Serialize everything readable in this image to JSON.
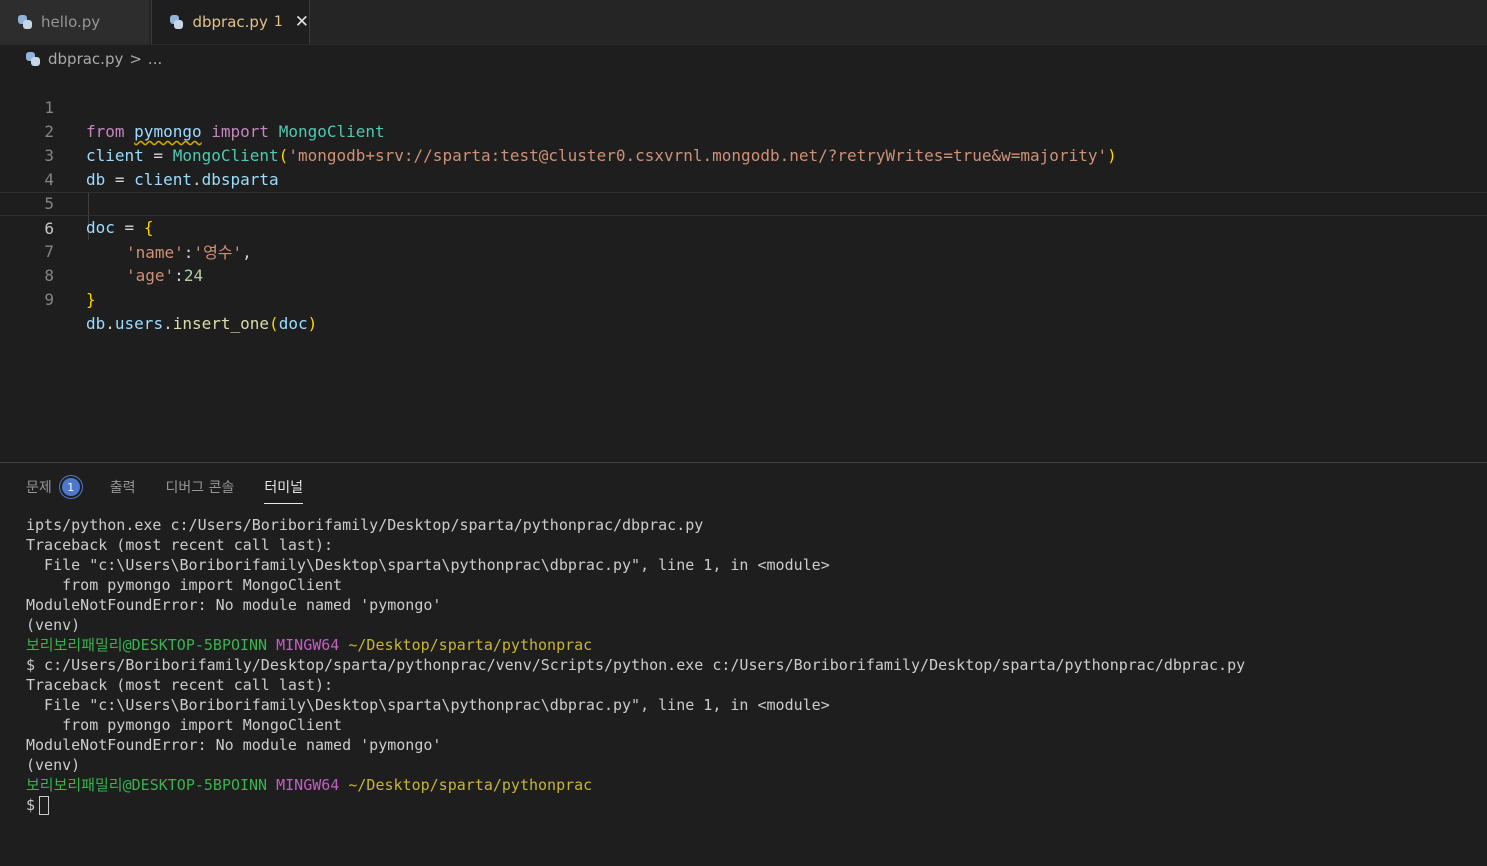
{
  "tabs": [
    {
      "label": "hello.py",
      "active": false
    },
    {
      "label": "dbprac.py",
      "badge": "1",
      "active": true
    }
  ],
  "close_glyph": "✕",
  "breadcrumb": {
    "file": "dbprac.py",
    "separator": ">",
    "more": "..."
  },
  "editor": {
    "line_numbers": [
      "1",
      "2",
      "3",
      "4",
      "5",
      "6",
      "7",
      "8",
      "9"
    ],
    "current_line": 6,
    "line1": {
      "kw1": "from",
      "module": "pymongo",
      "kw2": "import",
      "cls": "MongoClient"
    },
    "line2": {
      "var": "client",
      "eq": " = ",
      "cls": "MongoClient",
      "open": "(",
      "str": "'mongodb+srv://sparta:test@cluster0.csxvrnl.mongodb.net/?retryWrites=true&w=majority'",
      "close": ")"
    },
    "line3": {
      "var": "db",
      "eq": " = ",
      "obj": "client",
      "dot": ".",
      "attr": "dbsparta"
    },
    "line5": {
      "var": "doc",
      "eq": " = ",
      "brace": "{"
    },
    "line6": {
      "key": "'name'",
      "colon": ":",
      "val": "'영수'",
      "comma": ","
    },
    "line7": {
      "key": "'age'",
      "colon": ":",
      "num": "24"
    },
    "line8": {
      "brace": "}"
    },
    "line9": {
      "obj": "db",
      "dot1": ".",
      "attr": "users",
      "dot2": ".",
      "fn": "insert_one",
      "open": "(",
      "arg": "doc",
      "close": ")"
    }
  },
  "panel": {
    "tabs": [
      {
        "label": "문제",
        "badge": "1"
      },
      {
        "label": "출력"
      },
      {
        "label": "디버그 콘솔"
      },
      {
        "label": "터미널",
        "active": true
      }
    ]
  },
  "terminal": {
    "lines": [
      "ipts/python.exe c:/Users/Boriborifamily/Desktop/sparta/pythonprac/dbprac.py",
      "Traceback (most recent call last):",
      "  File \"c:\\Users\\Boriborifamily\\Desktop\\sparta\\pythonprac\\dbprac.py\", line 1, in <module>",
      "    from pymongo import MongoClient",
      "ModuleNotFoundError: No module named 'pymongo'",
      "(venv)"
    ],
    "prompt1": {
      "user": "보리보리패밀리@DESKTOP-5BPOINN",
      "system": "MINGW64",
      "path": "~/Desktop/sparta/pythonprac"
    },
    "command": "$ c:/Users/Boriborifamily/Desktop/sparta/pythonprac/venv/Scripts/python.exe c:/Users/Boriborifamily/Desktop/sparta/pythonprac/dbprac.py",
    "lines2": [
      "Traceback (most recent call last):",
      "  File \"c:\\Users\\Boriborifamily\\Desktop\\sparta\\pythonprac\\dbprac.py\", line 1, in <module>",
      "    from pymongo import MongoClient",
      "ModuleNotFoundError: No module named 'pymongo'",
      "(venv)"
    ],
    "prompt2": {
      "user": "보리보리패밀리@DESKTOP-5BPOINN",
      "system": "MINGW64",
      "path": "~/Desktop/sparta/pythonprac"
    },
    "input_prompt": "$"
  },
  "colors": {
    "background": "#1e1e1e",
    "tab_active_text": "#e2c08d",
    "keyword": "#c586c0",
    "variable": "#9cdcfe",
    "class": "#4ec9b0",
    "function": "#dcdcaa",
    "string": "#ce9178",
    "number": "#b5cea8",
    "terminal_user": "#3bb14f",
    "terminal_system": "#c35fc3",
    "terminal_path": "#c8b437",
    "badge": "#4d78cc"
  },
  "icons": [
    "python-file-icon",
    "close-icon",
    "chevron-right-icon",
    "problems-count-badge",
    "terminal-cursor"
  ]
}
